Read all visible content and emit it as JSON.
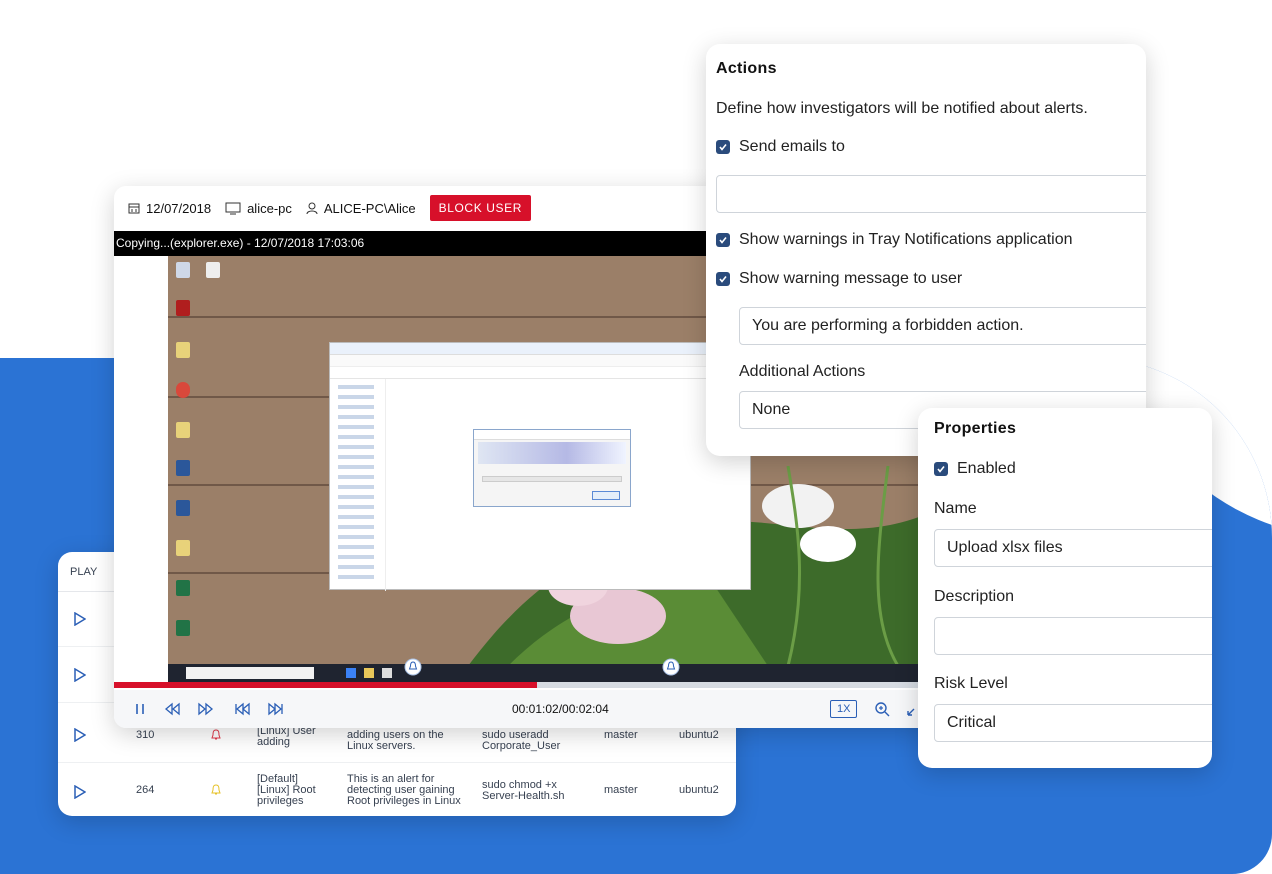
{
  "player": {
    "date": "12/07/2018",
    "computer": "alice-pc",
    "user": "ALICE-PC\\Alice",
    "block_button": "BLOCK USER",
    "event_bar": "Copying...(explorer.exe) - 12/07/2018 17:03:06",
    "time": "00:01:02/00:02:04",
    "speed": "1X",
    "progress": 0.51
  },
  "table": {
    "column_play": "PLAY",
    "rows": [
      {
        "id": "310",
        "name": "[Linux] User adding",
        "desc": "adding users on the Linux servers.",
        "command": "sudo useradd Corporate_User",
        "branch": "master",
        "host": "ubuntu2",
        "bell_color": "#e0394a"
      },
      {
        "id": "264",
        "name": "[Default] [Linux] Root privileges",
        "desc": "This is an alert for detecting user gaining Root privileges in Linux",
        "command": "sudo chmod +x Server-Health.sh",
        "branch": "master",
        "host": "ubuntu2",
        "bell_color": "#e6c229"
      }
    ]
  },
  "actions": {
    "title": "Actions",
    "description": "Define how investigators will be notified about alerts.",
    "send_emails_label": "Send emails to",
    "email_value": "",
    "tray_label": "Show warnings in Tray Notifications application",
    "warning_label": "Show warning message to user",
    "warning_message": "You are performing a forbidden action.",
    "additional_label": "Additional Actions",
    "additional_value": "None"
  },
  "properties": {
    "title": "Properties",
    "enabled_label": "Enabled",
    "name_label": "Name",
    "name_value": "Upload xlsx files",
    "description_label": "Description",
    "description_value": "",
    "risk_label": "Risk Level",
    "risk_value": "Critical"
  },
  "colors": {
    "accent_blue": "#2b73d4",
    "danger_red": "#d7102a",
    "checkbox": "#2a4b7c"
  }
}
